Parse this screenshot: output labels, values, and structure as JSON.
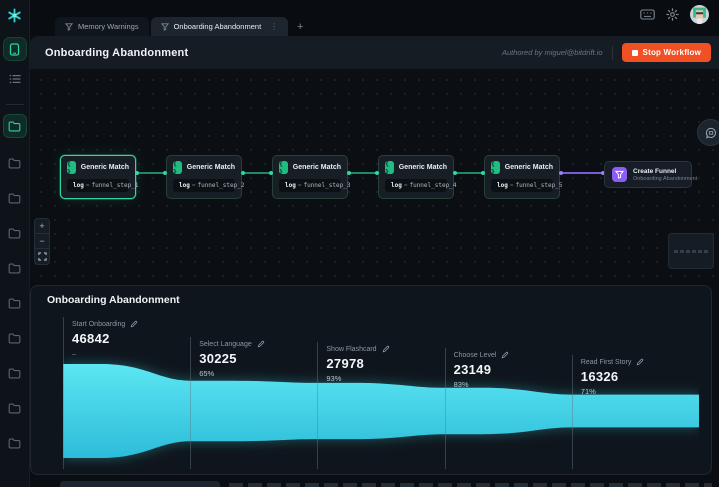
{
  "topbar": {
    "tabs": [
      {
        "label": "Memory Warnings",
        "active": false
      },
      {
        "label": "Onboarding Abandonment",
        "active": true
      }
    ],
    "new_tab_label": "+",
    "kebab_glyph": "⋮",
    "icons": [
      "keyboard-icon",
      "settings-gear-icon",
      "user-avatar"
    ]
  },
  "sidebar": {
    "items": [
      {
        "name": "devices",
        "icon": "phone-icon",
        "active": true
      },
      {
        "name": "logs",
        "icon": "list-icon",
        "active": false
      }
    ],
    "folders": [
      {
        "active": true
      },
      {
        "active": false
      },
      {
        "active": false
      },
      {
        "active": false
      },
      {
        "active": false
      },
      {
        "active": false
      },
      {
        "active": false
      },
      {
        "active": false
      },
      {
        "active": false
      },
      {
        "active": false
      }
    ]
  },
  "header": {
    "title": "Onboarding Abandonment",
    "authored_by": "Authored by miguel@bitdrift.io",
    "stop_button_label": "Stop Workflow",
    "stop_button_color": "#f05023"
  },
  "workflow": {
    "match_nodes": [
      {
        "title": "Generic Match",
        "field": "log",
        "op": "=",
        "value": "funnel_step_1",
        "selected": true
      },
      {
        "title": "Generic Match",
        "field": "log",
        "op": "=",
        "value": "funnel_step_2",
        "selected": false
      },
      {
        "title": "Generic Match",
        "field": "log",
        "op": "=",
        "value": "funnel_step_3",
        "selected": false
      },
      {
        "title": "Generic Match",
        "field": "log",
        "op": "=",
        "value": "funnel_step_4",
        "selected": false
      },
      {
        "title": "Generic Match",
        "field": "log",
        "op": "=",
        "value": "funnel_step_5",
        "selected": false
      }
    ],
    "match_icon_glyph": "{ }",
    "output_node": {
      "title": "Create Funnel",
      "subtitle": "Onboarding Abandonment"
    },
    "edge_green": "#1d8a66",
    "edge_purple": "#7a5cd8",
    "zoom_controls": [
      "zoom-in",
      "zoom-out",
      "fit-view"
    ],
    "minimap_node_count": 6
  },
  "chart_data": {
    "type": "area",
    "variant": "horizontal-funnel",
    "title": "Onboarding Abandonment",
    "categories": [
      "Start Onboarding",
      "Select Language",
      "Show Flashcard",
      "Choose Level",
      "Read First Story"
    ],
    "values": [
      46842,
      30225,
      27978,
      23149,
      16326
    ],
    "conversion_percents": [
      "–",
      "65%",
      "93%",
      "83%",
      "71%"
    ],
    "fill_top": "#5ce6f2",
    "fill_bottom": "#2cbcd9",
    "glow_color": "#3adcec",
    "grid": false,
    "legend": false
  }
}
